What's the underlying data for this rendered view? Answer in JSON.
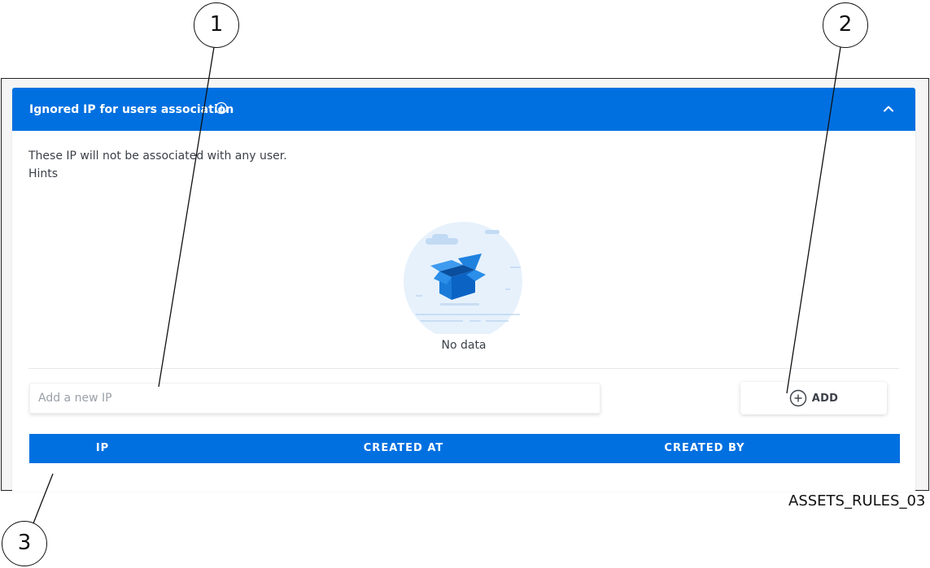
{
  "panel": {
    "title": "Ignored IP for users association",
    "description": "These IP will not be associated with any user.",
    "hints": "Hints",
    "empty_text": "No data"
  },
  "form": {
    "ip_placeholder": "Add a new IP",
    "add_label": "ADD"
  },
  "table": {
    "columns": [
      "IP",
      "CREATED AT",
      "CREATED BY"
    ]
  },
  "callouts": {
    "one": "1",
    "two": "2",
    "three": "3"
  },
  "caption": "ASSETS_RULES_03",
  "icons": {
    "info": "info-icon",
    "collapse": "chevron-up-icon",
    "add": "plus-circle-icon",
    "empty": "empty-box-illustration"
  },
  "colors": {
    "primary": "#0070e0",
    "header_text": "#ffffff",
    "body_text": "#3c4048"
  }
}
